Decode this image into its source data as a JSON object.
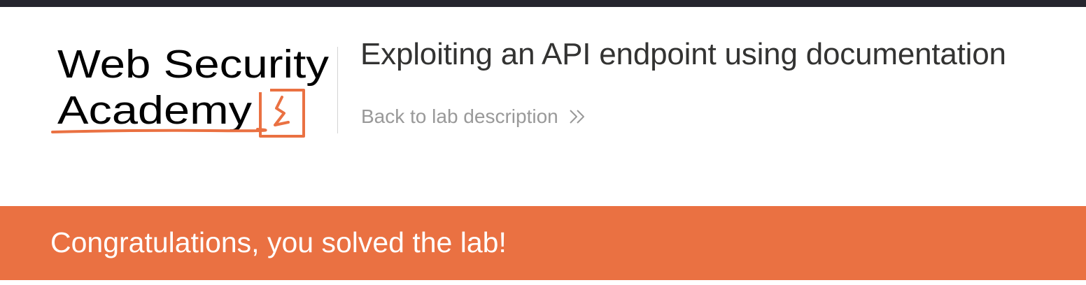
{
  "header": {
    "logo": {
      "line1": "Web Security",
      "line2": "Academy",
      "icon": "lightning-bolt-icon",
      "brand_color": "#ea7142"
    },
    "lab_title": "Exploiting an API endpoint using documentation",
    "back_link": {
      "label": "Back to lab description",
      "icon": "chevron-double-right-icon"
    }
  },
  "banner": {
    "message": "Congratulations, you solved the lab!",
    "background_color": "#ea7142"
  },
  "colors": {
    "top_strip": "#26262e",
    "title_text": "#333332",
    "link_text": "#999999"
  }
}
